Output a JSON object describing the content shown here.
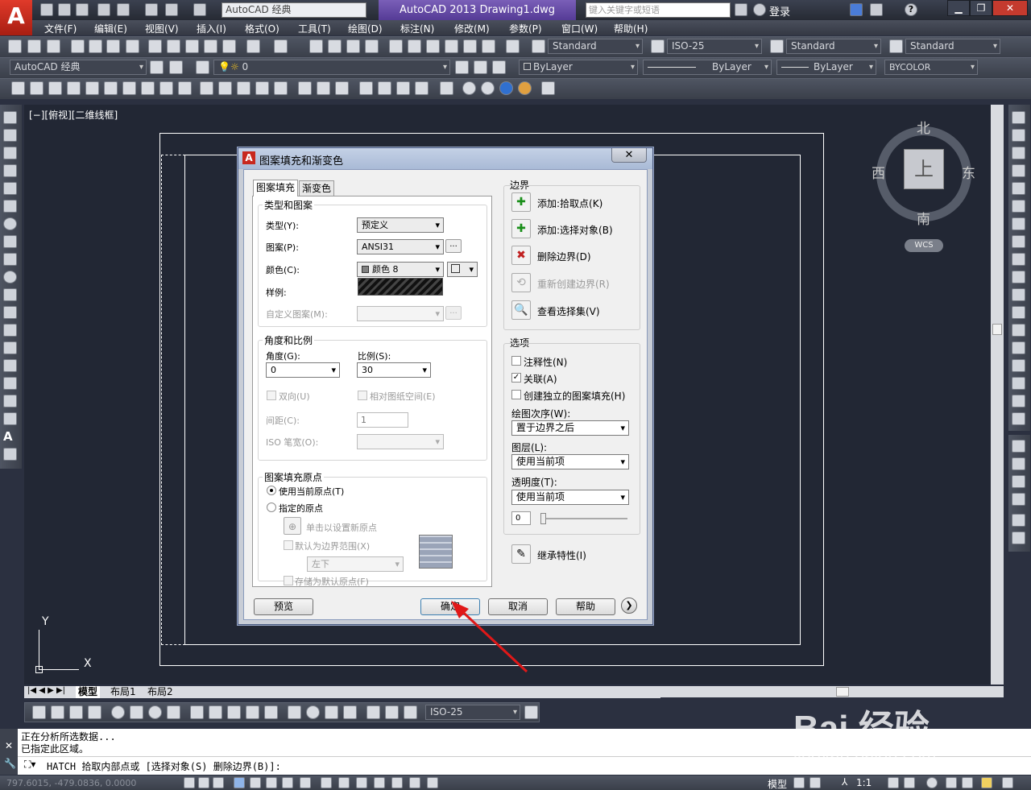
{
  "titlebar": {
    "app_logo": "A",
    "workspace_combo": "AutoCAD 经典",
    "app_title": "AutoCAD 2013    Drawing1.dwg",
    "search_placeholder": "键入关键字或短语",
    "login": "登录",
    "help_icon": "?"
  },
  "menubar": [
    "文件(F)",
    "编辑(E)",
    "视图(V)",
    "插入(I)",
    "格式(O)",
    "工具(T)",
    "绘图(D)",
    "标注(N)",
    "修改(M)",
    "参数(P)",
    "窗口(W)",
    "帮助(H)"
  ],
  "styles_toolbar": {
    "text_style": "Standard",
    "dim_style": "ISO-25",
    "table_style": "Standard",
    "mleader_style": "Standard"
  },
  "workspace_toolbar": {
    "workspace": "AutoCAD 经典",
    "layer": "0",
    "color": "ByLayer",
    "linetype": "ByLayer",
    "lineweight": "ByLayer",
    "plotstyle": "BYCOLOR"
  },
  "viewport": {
    "label": "[−][俯视][二维线框]",
    "compass": {
      "north": "北",
      "south": "南",
      "east": "东",
      "west": "西",
      "top": "上"
    },
    "wcs": "WCS",
    "ucs_x": "X",
    "ucs_y": "Y"
  },
  "layout_tabs": [
    "模型",
    "布局1",
    "布局2"
  ],
  "dim_toolbar": {
    "dim_style": "ISO-25"
  },
  "command": {
    "history": [
      "正在分析所选数据...",
      "已指定此区域。"
    ],
    "prompt": "HATCH 拾取内部点或 [选择对象(S) 删除边界(B)]:"
  },
  "statusbar": {
    "coords": "797.6015, -479.0836, 0.0000",
    "model": "模型",
    "scale": "1:1"
  },
  "watermark": {
    "brand": "Bai 经验",
    "url": "jingyan.baidu.com"
  },
  "dialog": {
    "title": "图案填充和渐变色",
    "close": "✕",
    "tabs": [
      "图案填充",
      "渐变色"
    ],
    "type_pattern": {
      "title": "类型和图案",
      "type_label": "类型(Y):",
      "type_value": "预定义",
      "pattern_label": "图案(P):",
      "pattern_value": "ANSI31",
      "color_label": "颜色(C):",
      "color_value": "颜色 8",
      "sample_label": "样例:",
      "custom_label": "自定义图案(M):",
      "ellipsis": "..."
    },
    "angle_scale": {
      "title": "角度和比例",
      "angle_label": "角度(G):",
      "angle_value": "0",
      "scale_label": "比例(S):",
      "scale_value": "30",
      "double_label": "双向(U)",
      "paper_label": "相对图纸空间(E)",
      "spacing_label": "间距(C):",
      "spacing_value": "1",
      "iso_label": "ISO 笔宽(O):"
    },
    "origin": {
      "title": "图案填充原点",
      "use_current": "使用当前原点(T)",
      "specified": "指定的原点",
      "click_set": "单击以设置新原点",
      "default_extents": "默认为边界范围(X)",
      "position": "左下",
      "store_default": "存储为默认原点(F)"
    },
    "boundaries": {
      "title": "边界",
      "add_pick": "添加:拾取点(K)",
      "add_select": "添加:选择对象(B)",
      "remove": "删除边界(D)",
      "recreate": "重新创建边界(R)",
      "view_sel": "查看选择集(V)"
    },
    "options": {
      "title": "选项",
      "annotative": "注释性(N)",
      "associative": "关联(A)",
      "separate": "创建独立的图案填充(H)",
      "draw_order_label": "绘图次序(W):",
      "draw_order": "置于边界之后",
      "layer_label": "图层(L):",
      "layer": "使用当前项",
      "transparency_label": "透明度(T):",
      "transparency": "使用当前项",
      "transparency_value": "0"
    },
    "inherit": "继承特性(I)",
    "buttons": {
      "preview": "预览",
      "ok": "确定",
      "cancel": "取消",
      "help": "帮助",
      "more": "❯"
    }
  }
}
